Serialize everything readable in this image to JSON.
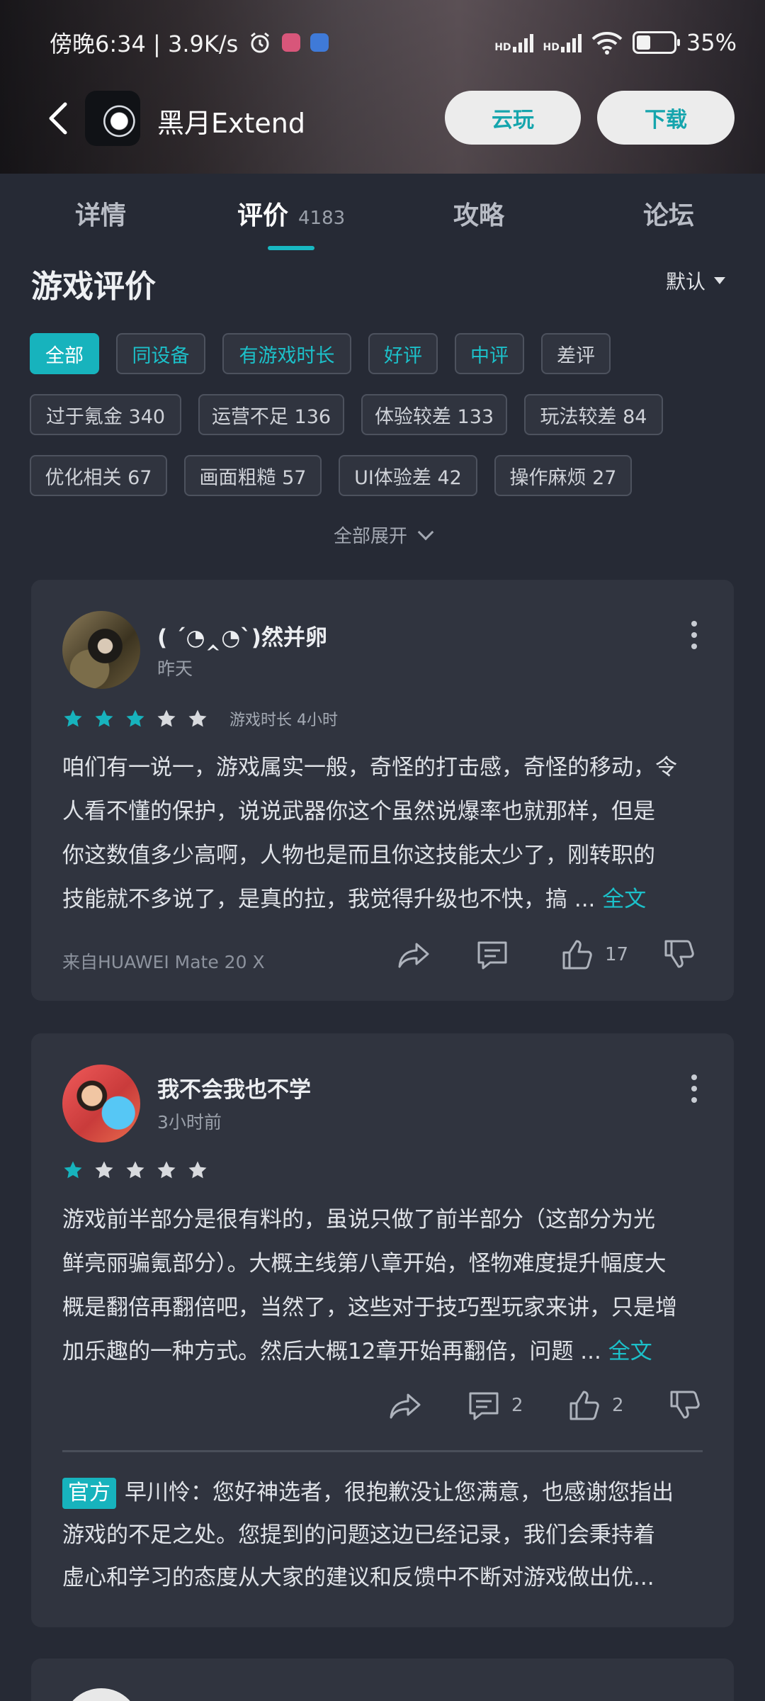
{
  "status_bar": {
    "time_speed": "傍晚6:34 | 3.9K/s",
    "battery": "35%"
  },
  "header": {
    "game_title": "黑月Extend",
    "cloud_play": "云玩",
    "download": "下载"
  },
  "tabs": [
    {
      "label": "详情"
    },
    {
      "label": "评价",
      "count": "4183"
    },
    {
      "label": "攻略"
    },
    {
      "label": "论坛"
    }
  ],
  "section": {
    "title": "游戏评价",
    "sort": "默认"
  },
  "filters": {
    "primary": [
      "全部",
      "同设备",
      "有游戏时长",
      "好评",
      "中评",
      "差评"
    ],
    "tags": [
      "过于氪金 340",
      "运营不足 136",
      "体验较差 133",
      "玩法较差 84",
      "优化相关 67",
      "画面粗糙 57",
      "UI体验差 42",
      "操作麻烦 27"
    ],
    "expand": "全部展开"
  },
  "reviews": [
    {
      "username": "( ´◔‸◔`)然并卵",
      "time": "昨天",
      "stars": 3,
      "playtime": "游戏时长 4小时",
      "lines": [
        "咱们有一说一，游戏属实一般，奇怪的打击感，奇怪的移动，令",
        "人看不懂的保护，说说武器你这个虽然说爆率也就那样，但是",
        "你这数值多少高啊，人物也是而且你这技能太少了，刚转职的",
        "技能就不多说了，是真的拉，我觉得升级也不快，搞 ... "
      ],
      "full_text": "全文",
      "device": "来自HUAWEI Mate 20 X",
      "comments": "",
      "likes": "17"
    },
    {
      "username": "我不会我也不学",
      "time": "3小时前",
      "stars": 1,
      "lines": [
        "游戏前半部分是很有料的，虽说只做了前半部分（这部分为光",
        "鲜亮丽骗氪部分）。大概主线第八章开始，怪物难度提升幅度大",
        "概是翻倍再翻倍吧，当然了，这些对于技巧型玩家来讲，只是增",
        "加乐趣的一种方式。然后大概12章开始再翻倍，问题 ... "
      ],
      "full_text": "全文",
      "comments": "2",
      "likes": "2",
      "official": {
        "badge": "官方",
        "lines": [
          "早川怜：您好神选者，很抱歉没让您满意，也感谢您指出",
          "游戏的不足之处。您提到的问题这边已经记录，我们会秉持着",
          "虚心和学习的态度从大家的建议和反馈中不断对游戏做出优..."
        ]
      }
    }
  ],
  "colors": {
    "accent": "#17b3bd",
    "background": "#262a35",
    "card": "#30343f"
  }
}
